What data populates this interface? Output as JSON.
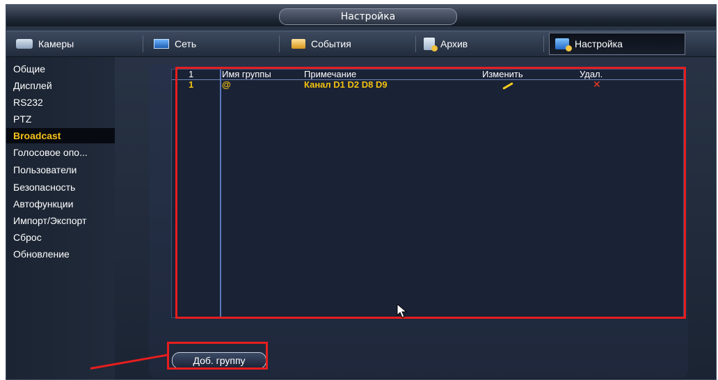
{
  "window": {
    "title": "Настройка"
  },
  "tabs": [
    {
      "label": "Камеры",
      "icon": "camera-icon"
    },
    {
      "label": "Сеть",
      "icon": "network-icon"
    },
    {
      "label": "События",
      "icon": "events-icon"
    },
    {
      "label": "Архив",
      "icon": "archive-icon"
    },
    {
      "label": "Настройка",
      "icon": "settings-icon",
      "active": true
    }
  ],
  "sidebar": {
    "items": [
      {
        "label": "Общие"
      },
      {
        "label": "Дисплей"
      },
      {
        "label": "RS232"
      },
      {
        "label": "PTZ"
      },
      {
        "label": "Broadcast",
        "active": true
      },
      {
        "label": "Голосовое опо..."
      },
      {
        "label": "Пользователи"
      },
      {
        "label": "Безопасность"
      },
      {
        "label": "Автофункции"
      },
      {
        "label": "Импорт/Экспорт"
      },
      {
        "label": "Сброс"
      },
      {
        "label": "Обновление"
      }
    ]
  },
  "table": {
    "headers": {
      "index": "1",
      "group_name": "Имя группы",
      "note": "Примечание",
      "edit": "Изменить",
      "delete": "Удал."
    },
    "rows": [
      {
        "index": "1",
        "group_name": "@",
        "note": "Канал D1 D2 D8 D9",
        "edit_icon": "pencil-icon",
        "delete_icon": "delete-x-icon"
      }
    ]
  },
  "actions": {
    "add_group": "Доб. группу"
  },
  "colors": {
    "accent_yellow": "#f2c10f",
    "highlight_red": "#e61e1e",
    "panel_bg": "#1f283b"
  }
}
